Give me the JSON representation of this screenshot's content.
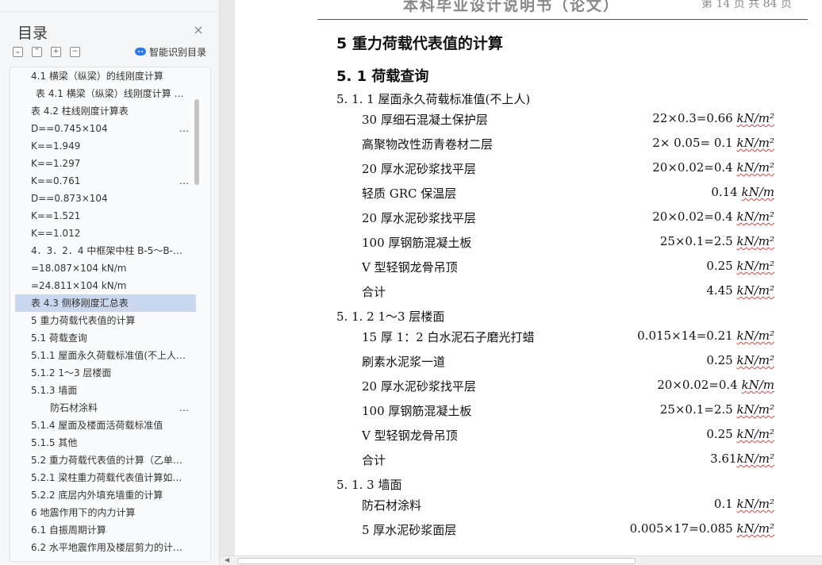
{
  "nav": {
    "title": "目录",
    "close_icon": "×",
    "tool_icons": [
      "expand-all",
      "collapse-up",
      "add-heading",
      "remove-heading"
    ],
    "smart_toc_label": "智能识别目录",
    "toc": [
      {
        "text": "4.1  横梁（纵梁）的线刚度计算",
        "indent": 1,
        "more": false,
        "selected": false
      },
      {
        "text": "表 4.1  横梁（纵梁）线刚度计算 …",
        "indent": 2,
        "more": false,
        "selected": false
      },
      {
        "text": "表 4.2  柱线刚度计算表",
        "indent": 1,
        "more": false,
        "selected": false
      },
      {
        "text": "D==0.745×104",
        "indent": 1,
        "more": true,
        "selected": false
      },
      {
        "text": "K==1.949",
        "indent": 1,
        "more": false,
        "selected": false
      },
      {
        "text": "K==1.297",
        "indent": 1,
        "more": false,
        "selected": false
      },
      {
        "text": "K==0.761",
        "indent": 1,
        "more": true,
        "selected": false
      },
      {
        "text": "D==0.873×104",
        "indent": 1,
        "more": false,
        "selected": false
      },
      {
        "text": "K==1.521",
        "indent": 1,
        "more": false,
        "selected": false
      },
      {
        "text": "K==1.012",
        "indent": 1,
        "more": false,
        "selected": false
      },
      {
        "text": "4．3．2．4  中框架中柱 B-5～B-…",
        "indent": 1,
        "more": false,
        "selected": false
      },
      {
        "text": "=18.087×104 kN/m",
        "indent": 1,
        "more": false,
        "selected": false
      },
      {
        "text": "=24.811×104 kN/m",
        "indent": 1,
        "more": false,
        "selected": false
      },
      {
        "text": "表 4.3  侧移刚度汇总表",
        "indent": 1,
        "more": false,
        "selected": true
      },
      {
        "text": "5  重力荷载代表值的计算",
        "indent": 1,
        "more": false,
        "selected": false
      },
      {
        "text": "5.1    荷载查询",
        "indent": 1,
        "more": false,
        "selected": false
      },
      {
        "text": "5.1.1    屋面永久荷载标准值(不上人…",
        "indent": 1,
        "more": false,
        "selected": false
      },
      {
        "text": "5.1.2    1～3 层楼面",
        "indent": 1,
        "more": false,
        "selected": false
      },
      {
        "text": "5.1.3    墙面",
        "indent": 1,
        "more": false,
        "selected": false
      },
      {
        "text": "防石材涂料",
        "indent": 3,
        "more": true,
        "selected": false
      },
      {
        "text": "5.1.4    屋面及楼面活荷载标准值",
        "indent": 1,
        "more": false,
        "selected": false
      },
      {
        "text": "5.1.5    其他",
        "indent": 1,
        "more": false,
        "selected": false
      },
      {
        "text": "5.2    重力荷载代表值的计算（乙单…",
        "indent": 1,
        "more": false,
        "selected": false
      },
      {
        "text": "5.2.1    梁柱重力荷载代表值计算如…",
        "indent": 1,
        "more": false,
        "selected": false
      },
      {
        "text": "5.2.2    底层内外填充墙重的计算",
        "indent": 1,
        "more": false,
        "selected": false
      },
      {
        "text": "6    地震作用下的内力计算",
        "indent": 1,
        "more": false,
        "selected": false
      },
      {
        "text": "6.1    自振周期计算",
        "indent": 1,
        "more": false,
        "selected": false
      },
      {
        "text": "6.2    水平地震作用及楼层剪力的计…",
        "indent": 1,
        "more": false,
        "selected": false
      }
    ]
  },
  "doc": {
    "header_left": "本科毕业设计说明书（论文）",
    "header_right": "第 14 页  共 84 页",
    "h1": "5  重力荷载代表值的计算",
    "h2": "5. 1    荷载查询",
    "sections": [
      {
        "title": "5. 1. 1    屋面永久荷载标准值(不上人)",
        "rows": [
          {
            "name": "30 厚细石混凝土保护层",
            "calc": "22×0.3=0.66 ",
            "unit": "kN/m²"
          },
          {
            "name": "高聚物改性沥青卷材二层",
            "calc": "2× 0.05= 0.1 ",
            "unit": "kN/m²"
          },
          {
            "name": "20 厚水泥砂浆找平层",
            "calc": "20×0.02=0.4 ",
            "unit": "kN/m²"
          },
          {
            "name": "轻质 GRC 保温层",
            "calc": "0.14 ",
            "unit": "kN/m"
          },
          {
            "name": "20 厚水泥砂浆找平层",
            "calc": "20×0.02=0.4 ",
            "unit": "kN/m²"
          },
          {
            "name": "100 厚钢筋混凝土板",
            "calc": "25×0.1=2.5 ",
            "unit": "kN/m²"
          },
          {
            "name": "V 型轻钢龙骨吊顶",
            "calc": "0.25 ",
            "unit": "kN/m²"
          },
          {
            "name": "合计",
            "calc": "4.45 ",
            "unit": "kN/m²"
          }
        ]
      },
      {
        "title": "5. 1. 2    1～3 层楼面",
        "rows": [
          {
            "name": "15 厚 1：2 白水泥石子磨光打蜡",
            "calc": "0.015×14=0.21 ",
            "unit": "kN/m²"
          },
          {
            "name": "刷素水泥浆一道",
            "calc": "0.25 ",
            "unit": "kN/m²"
          },
          {
            "name": "20 厚水泥砂浆找平层",
            "calc": "20×0.02=0.4 ",
            "unit": "kN/m"
          },
          {
            "name": "100 厚钢筋混凝土板",
            "calc": "25×0.1=2.5 ",
            "unit": "kN/m²"
          },
          {
            "name": "V 型轻钢龙骨吊顶",
            "calc": "0.25 ",
            "unit": "kN/m²"
          },
          {
            "name": "合计",
            "calc": "3.61",
            "unit": "kN/m²"
          }
        ]
      },
      {
        "title": "5. 1. 3    墙面",
        "rows": [
          {
            "name": "防石材涂料",
            "calc": "0.1 ",
            "unit": "kN/m²"
          },
          {
            "name": "5 厚水泥砂浆面层",
            "calc": "0.005×17=0.085 ",
            "unit": "kN/m²"
          }
        ]
      }
    ]
  }
}
